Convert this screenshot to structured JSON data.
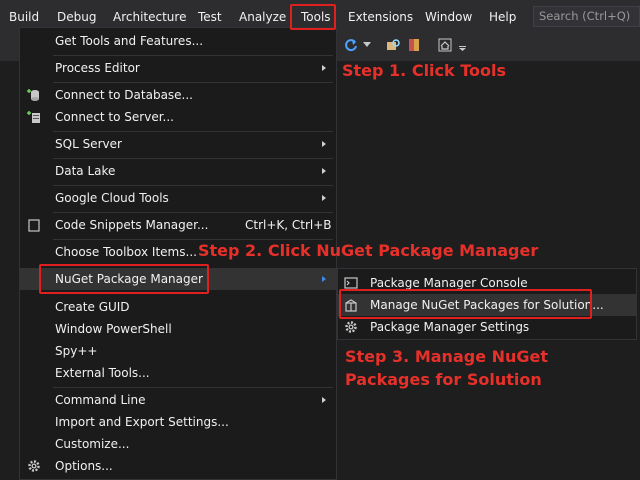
{
  "menubar": {
    "items": [
      "Build",
      "Debug",
      "Architecture",
      "Test",
      "Analyze",
      "Tools",
      "Extensions",
      "Window",
      "Help"
    ],
    "search_placeholder": "Search (Ctrl+Q)"
  },
  "tools_menu": {
    "items": [
      {
        "label": "Get Tools and Features..."
      },
      {
        "label": "Process Editor",
        "submenu": true
      },
      {
        "label": "Connect to Database...",
        "icon": "database-connect-icon"
      },
      {
        "label": "Connect to Server...",
        "icon": "server-connect-icon"
      },
      {
        "label": "SQL Server",
        "submenu": true
      },
      {
        "label": "Data Lake",
        "submenu": true
      },
      {
        "label": "Google Cloud Tools",
        "submenu": true
      },
      {
        "label": "Code Snippets Manager...",
        "shortcut": "Ctrl+K, Ctrl+B",
        "icon": "snippet-icon"
      },
      {
        "label": "Choose Toolbox Items..."
      },
      {
        "label": "NuGet Package Manager",
        "submenu": true
      },
      {
        "label": "Create GUID"
      },
      {
        "label": "Window PowerShell"
      },
      {
        "label": "Spy++"
      },
      {
        "label": "External Tools..."
      },
      {
        "label": "Command Line",
        "submenu": true
      },
      {
        "label": "Import and Export Settings..."
      },
      {
        "label": "Customize..."
      },
      {
        "label": "Options...",
        "icon": "gear-icon"
      }
    ]
  },
  "nuget_submenu": {
    "items": [
      {
        "label": "Package Manager Console",
        "icon": "console-icon"
      },
      {
        "label": "Manage NuGet Packages for Solution...",
        "icon": "package-icon"
      },
      {
        "label": "Package Manager Settings",
        "icon": "gear-icon"
      }
    ]
  },
  "annotations": {
    "step1": "Step 1. Click Tools",
    "step2": "Step 2. Click NuGet Package Manager",
    "step3_line1": "Step 3. Manage NuGet",
    "step3_line2": "Packages for Solution"
  },
  "colors": {
    "menu_bg": "#1b1b1c",
    "chrome_bg": "#2d2d30",
    "highlight": "#333334",
    "annotation_red": "#e01f1f"
  }
}
